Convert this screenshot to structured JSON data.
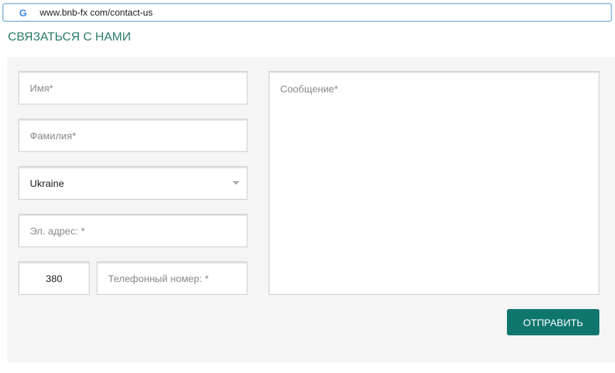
{
  "browser": {
    "url": "www.bnb-fx com/contact-us",
    "google_icon": "G"
  },
  "page": {
    "title": "СВЯЗАТЬСЯ С НАМИ"
  },
  "form": {
    "first_name_placeholder": "Имя*",
    "last_name_placeholder": "Фамилия*",
    "country_value": "Ukraine",
    "email_placeholder": "Эл. адрес: *",
    "phone_code_value": "380",
    "phone_placeholder": "Телефонный номер: *",
    "message_placeholder": "Сообщение*",
    "submit_label": "ОТПРАВИТЬ"
  }
}
